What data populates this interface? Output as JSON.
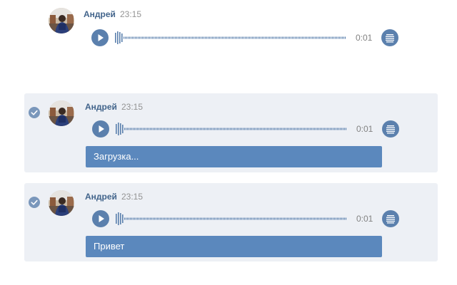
{
  "messages": [
    {
      "author": "Андрей",
      "time": "23:15",
      "duration": "0:01",
      "selected": false,
      "transcript": ""
    },
    {
      "author": "Андрей",
      "time": "23:15",
      "duration": "0:01",
      "selected": true,
      "transcript": "Загрузка..."
    },
    {
      "author": "Андрей",
      "time": "23:15",
      "duration": "0:01",
      "selected": true,
      "transcript": "Привет"
    }
  ],
  "icons": {
    "play": "play-icon",
    "transcribe": "text-lines-icon",
    "check": "checkmark-icon",
    "avatar": "user-avatar"
  },
  "colors": {
    "accent": "#5b80ad",
    "author": "#42648b",
    "selected_bg": "#edf0f5",
    "transcript_bg": "#5b88bd",
    "time": "#939393"
  }
}
